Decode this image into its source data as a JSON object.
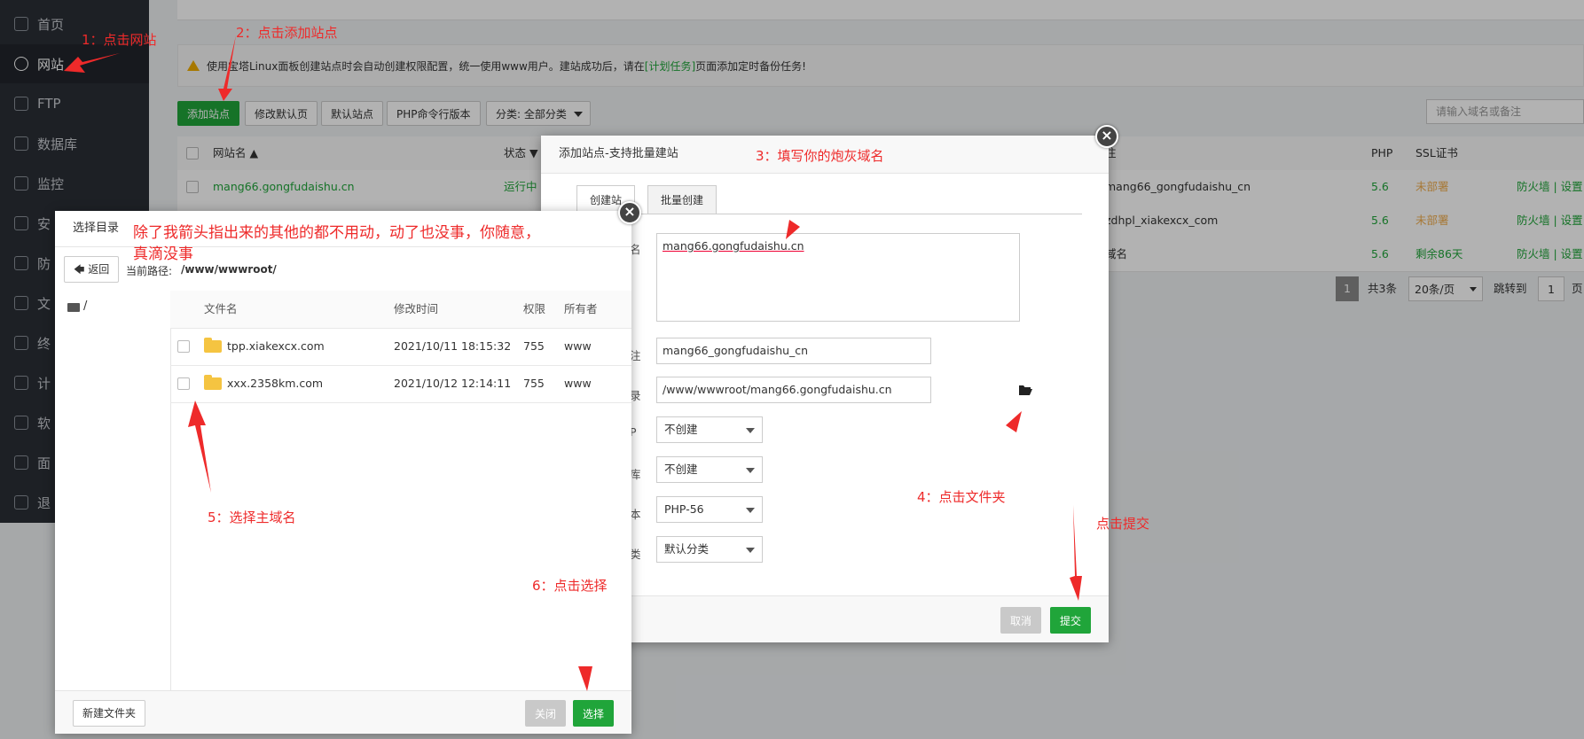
{
  "sidebar": {
    "items": [
      {
        "label": "首页",
        "icon": "home-icon"
      },
      {
        "label": "网站",
        "icon": "globe-icon"
      },
      {
        "label": "FTP",
        "icon": "ftp-icon"
      },
      {
        "label": "数据库",
        "icon": "database-icon"
      },
      {
        "label": "监控",
        "icon": "monitor-icon"
      },
      {
        "label": "安",
        "icon": "shield-icon"
      },
      {
        "label": "防",
        "icon": "firewall-icon"
      },
      {
        "label": "文",
        "icon": "folder-icon"
      },
      {
        "label": "终",
        "icon": "terminal-icon"
      },
      {
        "label": "计",
        "icon": "calendar-icon"
      },
      {
        "label": "软",
        "icon": "apps-icon"
      },
      {
        "label": "面",
        "icon": "gear-icon"
      },
      {
        "label": "退",
        "icon": "logout-icon"
      }
    ]
  },
  "notice": {
    "prefix": "使用宝塔Linux面板创建站点时会自动创建权限配置，统一使用www用户。建站成功后，请在",
    "link": "[计划任务]",
    "suffix": "页面添加定时备份任务!"
  },
  "toolbar": {
    "add_site": "添加站点",
    "edit_default": "修改默认页",
    "default_site": "默认站点",
    "php_cli": "PHP命令行版本",
    "category": "分类: 全部分类",
    "search_placeholder": "请输入域名或备注"
  },
  "table": {
    "headers": {
      "name": "网站名 ▲",
      "status": "状态 ▼",
      "remark": "注",
      "php": "PHP",
      "ssl": "SSL证书"
    },
    "rows": [
      {
        "name": "mang66.gongfudaishu.cn",
        "status": "运行中",
        "remark": "mang66_gongfudaishu_cn",
        "php": "5.6",
        "ssl": "未部署",
        "ops": "防火墙 | 设置"
      },
      {
        "name": "",
        "status": "",
        "remark": "zdhpl_xiakexcx_com",
        "php": "5.6",
        "ssl": "未部署",
        "ops": "防火墙 | 设置"
      },
      {
        "name": "",
        "status": "",
        "remark": "域名",
        "php": "5.6",
        "ssl": "剩余86天",
        "ops": "防火墙 | 设置"
      }
    ],
    "pager": {
      "page": "1",
      "total": "共3条",
      "per_page": "20条/页",
      "jump_label": "跳转到",
      "jump_value": "1",
      "page_unit": "页"
    }
  },
  "add_dialog": {
    "title": "添加站点-支持批量建站",
    "tab_create": "创建站",
    "tab_batch": "批量创建",
    "label_domain": "名",
    "domain_value": "mang66.gongfudaishu.cn",
    "label_remark": "注",
    "remark_value": "mang66_gongfudaishu_cn",
    "label_root": "录",
    "root_value": "/www/wwwroot/mang66.gongfudaishu.cn",
    "label_ftp": "P",
    "ftp_value": "不创建",
    "label_db": "库",
    "db_value": "不创建",
    "label_php": "本",
    "php_value": "PHP-56",
    "label_cat": "类",
    "cat_value": "默认分类",
    "cancel": "取消",
    "submit": "提交"
  },
  "file_dialog": {
    "title": "选择目录",
    "back": "返回",
    "path_label": "当前路径:",
    "path_value": "/www/wwwroot/",
    "tree_root": "/",
    "headers": {
      "name": "文件名",
      "mtime": "修改时间",
      "perm": "权限",
      "owner": "所有者"
    },
    "rows": [
      {
        "name": "tpp.xiakexcx.com",
        "mtime": "2021/10/11 18:15:32",
        "perm": "755",
        "owner": "www"
      },
      {
        "name": "xxx.2358km.com",
        "mtime": "2021/10/12 12:14:11",
        "perm": "755",
        "owner": "www"
      }
    ],
    "new_folder": "新建文件夹",
    "close": "关闭",
    "select": "选择"
  },
  "annotations": {
    "a1": "1：点击网站",
    "a2": "2：点击添加站点",
    "a3": "3：填写你的炮灰域名",
    "a4": "4：点击文件夹",
    "a5": "5：选择主域名",
    "a6": "6：点击选择",
    "a7": "点击提交",
    "note_line1": "除了我箭头指出来的其他的都不用动，动了也没事，你随意，",
    "note_line2": "真滴没事"
  },
  "colors": {
    "accent": "#20a53a",
    "annotation": "#ee2a2a",
    "sidebar": "#2a2f36"
  }
}
